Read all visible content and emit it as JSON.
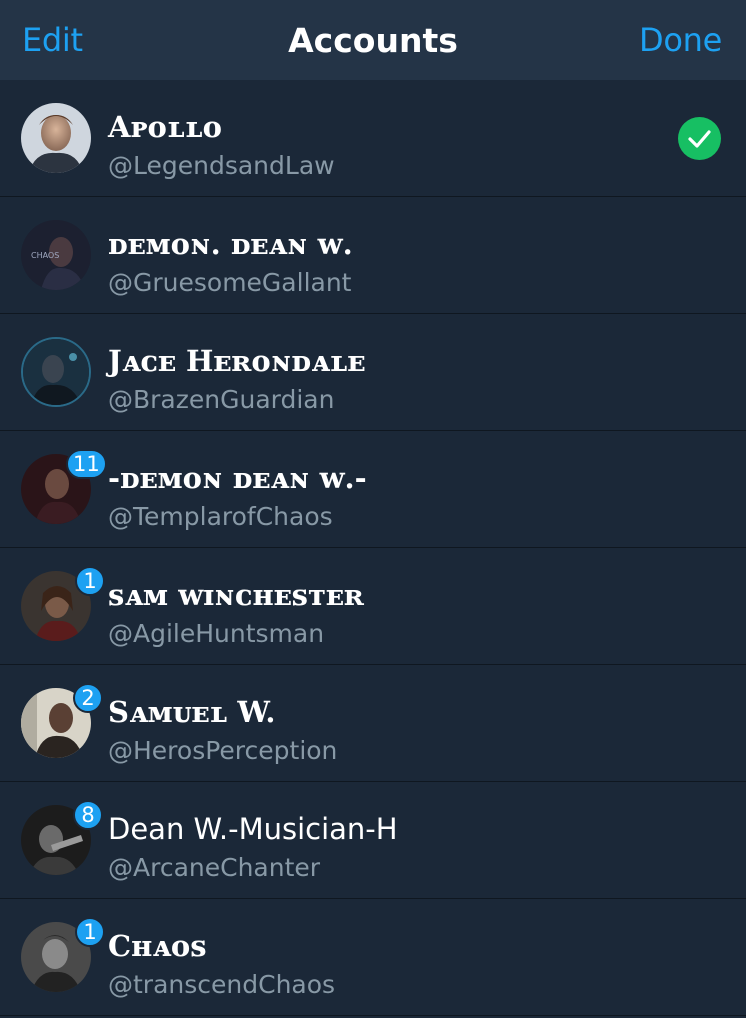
{
  "navbar": {
    "edit_label": "Edit",
    "title": "Accounts",
    "done_label": "Done",
    "accent_color": "#1da1f2"
  },
  "accounts": [
    {
      "name": "Aᴘᴏʟʟᴏ",
      "handle": "@LegendsandLaw",
      "badge": "",
      "selected": true
    },
    {
      "name": "ᴅᴇᴍᴏɴ. ᴅᴇᴀɴ ᴡ.",
      "handle": "@GruesomeGallant",
      "badge": "",
      "selected": false
    },
    {
      "name": "Jᴀᴄᴇ Hᴇʀᴏɴᴅᴀʟᴇ",
      "handle": "@BrazenGuardian",
      "badge": "",
      "selected": false
    },
    {
      "name": "-ᴅᴇᴍᴏɴ ᴅᴇᴀɴ ᴡ.-",
      "handle": "@TemplarofChaos",
      "badge": "11",
      "selected": false
    },
    {
      "name": "ꜱᴀᴍ ᴡɪɴᴄʜᴇꜱᴛᴇʀ",
      "handle": "@AgileHuntsman",
      "badge": "1",
      "selected": false
    },
    {
      "name": "Sᴀᴍᴜᴇʟ W.",
      "handle": "@HerosPerception",
      "badge": "2",
      "selected": false
    },
    {
      "name": "Dean W.-Musician-H",
      "handle": "@ArcaneChanter",
      "badge": "8",
      "selected": false
    },
    {
      "name": "Cʜᴀᴏꜱ",
      "handle": "@transcendChaos",
      "badge": "1",
      "selected": false
    }
  ],
  "colors": {
    "background": "#1b2838",
    "navbar": "#243447",
    "handle_text": "#8899a6",
    "badge": "#1da1f2",
    "check": "#17bf63"
  },
  "icons": {
    "check": "checkmark-circle-icon"
  }
}
